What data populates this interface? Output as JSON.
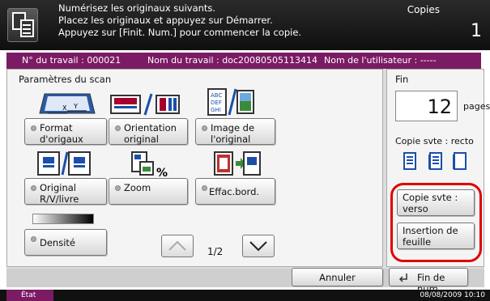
{
  "header": {
    "message_line1": "Numérisez les originaux suivants.",
    "message_line2": "Placez les originaux et appuyez sur Démarrer.",
    "message_line3": "Appuyez sur [Finit. Num.] pour commencer la copie.",
    "mode": "Copies",
    "copy_count": "1"
  },
  "job": {
    "job_number": "N° du travail : 000021",
    "job_name": "Nom du travail : doc20080505113414",
    "user_name": "Nom de l'utilisateur : -----"
  },
  "scan_panel": {
    "title": "Paramètres du scan",
    "buttons": {
      "format": "Format d'origaux",
      "orientation": "Orientation original",
      "image": "Image de l'original",
      "duplex": "Original R/V/livre",
      "zoom": "Zoom",
      "erase": "Effac.bord.",
      "density": "Densité"
    },
    "page_indicator": "1/2"
  },
  "finish_panel": {
    "title": "Fin",
    "pages_value": "12",
    "pages_unit": "pages",
    "copy_mode_label": "Copie svte : recto",
    "copy_verso_button": "Copie svte : verso",
    "insert_sheet_button": "Insertion de feuille"
  },
  "footer": {
    "cancel_button": "Annuler",
    "finish_button": "Fin de num"
  },
  "status": {
    "state": "État",
    "datetime": "08/08/2009   10:10"
  },
  "colors": {
    "accent": "#7b1b64",
    "highlight": "#e00000"
  },
  "icons": [
    "scan-icon",
    "format-icon",
    "orientation-icon",
    "image-icon",
    "duplex-icon",
    "zoom-icon",
    "erase-icon",
    "density-bar",
    "up-icon",
    "down-icon",
    "simplex-icon",
    "enter-icon"
  ]
}
